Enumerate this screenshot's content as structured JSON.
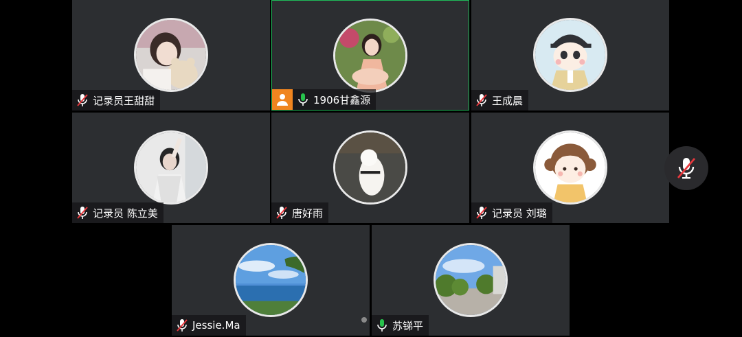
{
  "participants": [
    {
      "name": "记录员王甜甜",
      "mic": "muted",
      "speaking": false,
      "avatar": "photo-girl-with-teddy"
    },
    {
      "name": "1906甘鑫源",
      "mic": "active",
      "speaking": true,
      "host_badge": "person-icon",
      "avatar": "photo-girl-garden"
    },
    {
      "name": "王成晨",
      "mic": "muted",
      "speaking": false,
      "avatar": "cartoon-boy-cap"
    },
    {
      "name": "记录员 陈立美",
      "mic": "muted",
      "speaking": false,
      "avatar": "photo-girl-selfie"
    },
    {
      "name": "唐好雨",
      "mic": "muted",
      "speaking": false,
      "avatar": "photo-white-dog"
    },
    {
      "name": "记录员 刘璐",
      "mic": "muted",
      "speaking": false,
      "avatar": "cartoon-girl"
    },
    {
      "name": "Jessie.Ma",
      "mic": "muted",
      "speaking": false,
      "avatar": "photo-sea-sky"
    },
    {
      "name": "苏锑平",
      "mic": "active",
      "speaking": false,
      "avatar": "photo-street-trees"
    }
  ],
  "controls": {
    "self_mic": "muted"
  },
  "colors": {
    "tile_bg": "#2c2e31",
    "speaking_border": "#1fbe5a",
    "mic_muted": "#e8383d",
    "mic_active": "#27c24c",
    "host_badge": "#f0851f"
  }
}
